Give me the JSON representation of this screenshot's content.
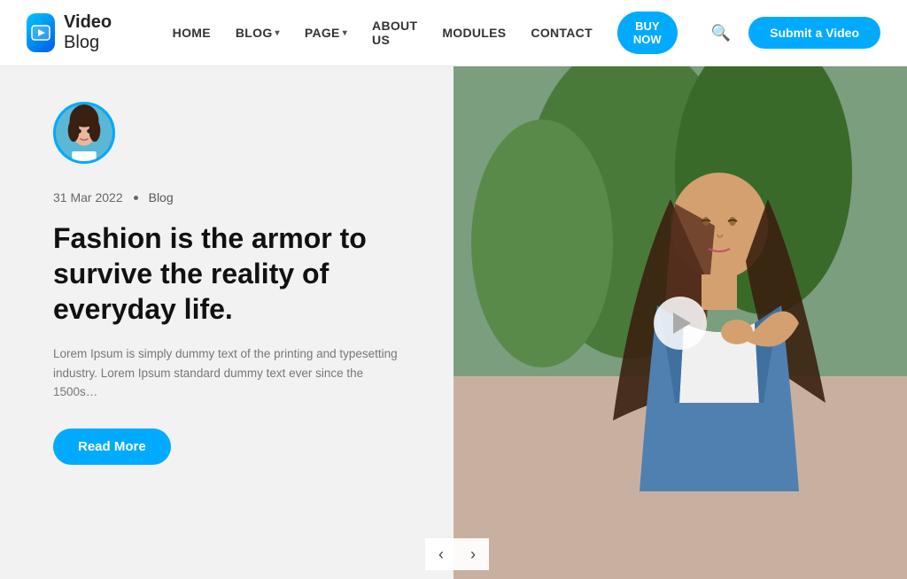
{
  "navbar": {
    "logo_text_bold": "Video",
    "logo_text_normal": " Blog",
    "nav_items": [
      {
        "label": "HOME",
        "has_dropdown": false
      },
      {
        "label": "BLOG",
        "has_dropdown": true
      },
      {
        "label": "PAGE",
        "has_dropdown": true
      },
      {
        "label": "ABOUT US",
        "has_dropdown": false
      },
      {
        "label": "MODULES",
        "has_dropdown": false
      },
      {
        "label": "CONTACT",
        "has_dropdown": false
      }
    ],
    "buy_now_label": "BUY NOW",
    "search_icon": "search",
    "submit_btn_label": "Submit a Video"
  },
  "post": {
    "date": "31 Mar 2022",
    "dot": "•",
    "category": "Blog",
    "title": "Fashion is the armor to survive the reality of everyday life.",
    "excerpt": "Lorem Ipsum is simply dummy text of the printing and typesetting industry. Lorem Ipsum standard dummy text ever since the 1500s…",
    "read_more": "Read More"
  },
  "carousel": {
    "prev_label": "‹",
    "next_label": "›"
  },
  "colors": {
    "accent": "#00aaff"
  }
}
